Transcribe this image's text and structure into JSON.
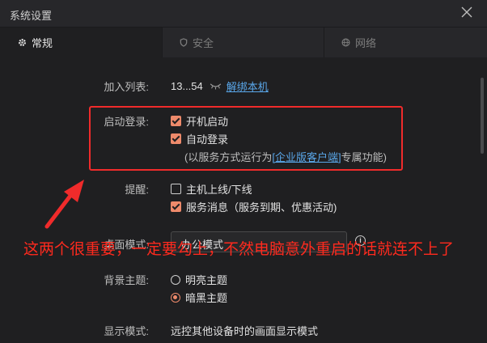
{
  "window": {
    "title": "系统设置"
  },
  "tabs": [
    {
      "label": "常规",
      "icon": "gear-icon",
      "active": true
    },
    {
      "label": "安全",
      "icon": "shield-icon",
      "active": false
    },
    {
      "label": "网络",
      "icon": "globe-icon",
      "active": false
    }
  ],
  "device": {
    "label": "加入列表:",
    "value": "13...54",
    "unbind": "解绑本机"
  },
  "startup": {
    "label": "启动登录:",
    "boot": {
      "label": "开机启动",
      "checked": true
    },
    "autologin": {
      "label": "自动登录",
      "checked": true
    },
    "note_prefix": "(以服务方式运行为",
    "note_link": "[企业版客户端]",
    "note_suffix": "专属功能)"
  },
  "reminder": {
    "label": "提醒:",
    "online": {
      "label": "主机上线/下线",
      "checked": false
    },
    "service": {
      "label": "服务消息（服务到期、优惠活动)",
      "checked": true
    }
  },
  "desktop": {
    "label": "桌面模式:",
    "value": "办公模式"
  },
  "theme": {
    "label": "背景主题:",
    "light": {
      "label": "明亮主题",
      "selected": false
    },
    "dark": {
      "label": "暗黑主题",
      "selected": true
    }
  },
  "display": {
    "label": "显示模式:",
    "value": "远控其他设备时的画面显示模式"
  },
  "annotation": "这两个很重要，一定要勾上，不然电脑意外重启的话就连不上了",
  "colors": {
    "accent": "#ee8a6b",
    "annotation": "#f02b2b",
    "link": "#5aa7ea",
    "background": "#1f1f21"
  }
}
